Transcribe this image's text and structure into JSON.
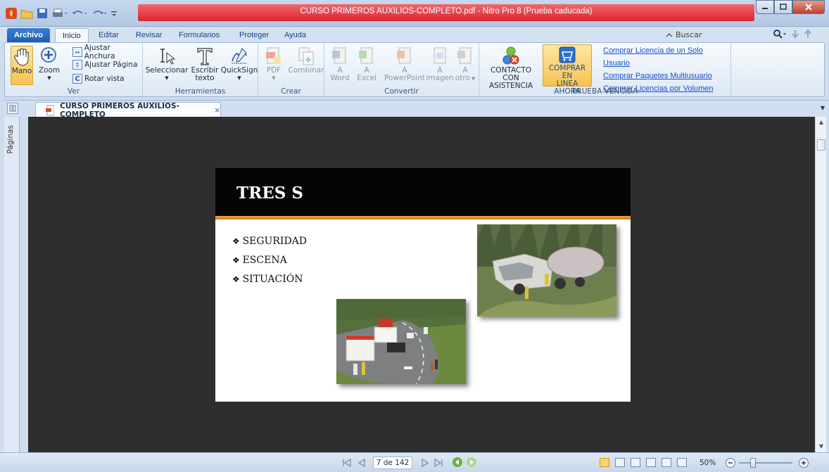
{
  "window": {
    "title": "CURSO PRIMEROS AUXILIOS-COMPLETO.pdf - Nitro Pro 8 (Prueba caducada)"
  },
  "tabs": [
    "Archivo",
    "Inicio",
    "Editar",
    "Revisar",
    "Formularios",
    "Proteger",
    "Ayuda"
  ],
  "search": {
    "placeholder": "Buscar"
  },
  "ribbon": {
    "ver": {
      "label": "Ver",
      "mano": "Mano",
      "zoom": "Zoom",
      "ajustar_anchura": "Ajustar Anchura",
      "ajustar_pagina": "Ajustar Página",
      "rotar_vista": "Rotar vista"
    },
    "herramientas": {
      "label": "Herramientas",
      "seleccionar": "Seleccionar",
      "escribir": "Escribir",
      "texto": "texto",
      "quicksign": "QuickSign"
    },
    "crear": {
      "label": "Crear",
      "pdf": "PDF",
      "combinar": "Combinar"
    },
    "convertir": {
      "label": "Convertir",
      "a": "A",
      "word": "Word",
      "excel": "Excel",
      "powerpoint": "PowerPoint",
      "imagen": "imagen",
      "otro": "otro"
    },
    "prueba": {
      "label": "PRUEBA VENCIDA",
      "contacto1": "CONTACTO CON",
      "contacto2": "ASISTENCIA",
      "comprar1": "COMPRAR EN",
      "comprar2": "LINEA AHORA",
      "links": [
        "Comprar Licencia de un Solo Usuario",
        "Comprar Paquetes Multiusuario",
        "Comprar Licencias por Volumen"
      ]
    }
  },
  "document": {
    "tab_title": "CURSO PRIMEROS AUXILIOS-COMPLETO",
    "close": "×"
  },
  "panel": {
    "pages_label": "Páginas"
  },
  "slide": {
    "title": "TRES S",
    "bullets": [
      "SEGURIDAD",
      "ESCENA",
      "SITUACIÓN"
    ]
  },
  "status": {
    "page": "7 de 142",
    "zoom": "50%"
  },
  "colors": {
    "accent_orange": "#e38a24",
    "title_red": "#dd3038",
    "link_blue": "#1750c8"
  }
}
